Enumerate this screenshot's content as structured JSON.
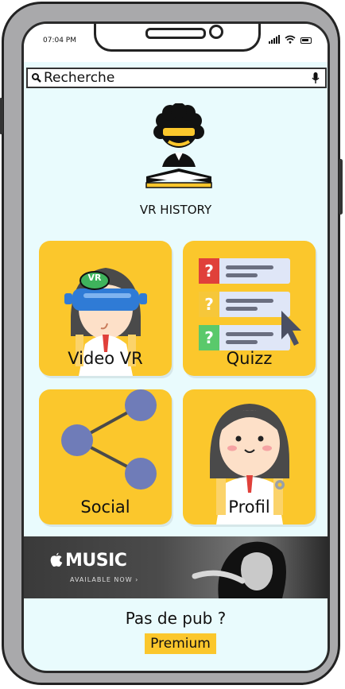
{
  "status_bar": {
    "time": "07:04 PM"
  },
  "search": {
    "text": "Recherche"
  },
  "app": {
    "title": "VR HISTORY"
  },
  "tiles": [
    {
      "label": "Video VR",
      "icon": "vr-headset-icon",
      "badge": "VR"
    },
    {
      "label": "Quizz",
      "icon": "quiz-list-icon"
    },
    {
      "label": "Social",
      "icon": "share-icon"
    },
    {
      "label": "Profil",
      "icon": "profile-avatar-icon"
    }
  ],
  "ad": {
    "brand": "MUSIC",
    "subtitle": "AVAILABLE NOW ›"
  },
  "footer": {
    "no_ads_text": "Pas de pub ?",
    "premium_label": "Premium"
  },
  "colors": {
    "tile": "#fbc72c",
    "background": "#e9fbfd",
    "share_nodes": "#6f7cb8"
  }
}
